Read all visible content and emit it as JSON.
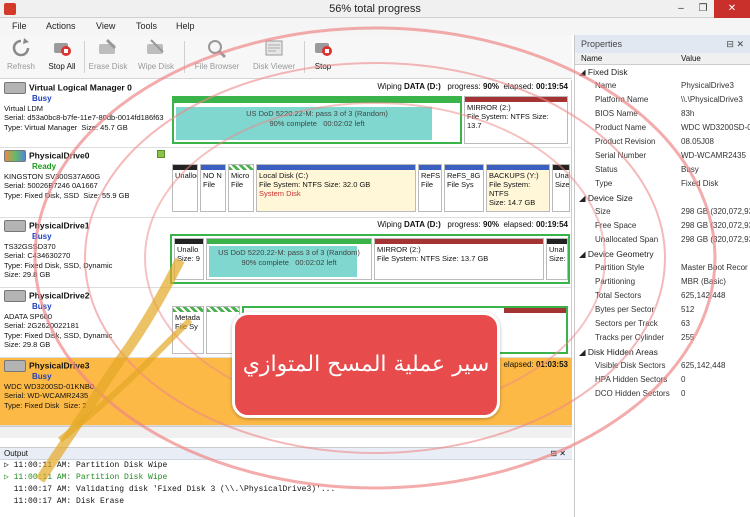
{
  "window": {
    "title": "56% total progress"
  },
  "menu": [
    "File",
    "Actions",
    "View",
    "Tools",
    "Help"
  ],
  "toolbar": [
    {
      "label": "Refresh",
      "enabled": false,
      "icon": "refresh-icon"
    },
    {
      "label": "Stop All",
      "enabled": true,
      "icon": "stop-all-icon"
    },
    {
      "label": "Erase Disk",
      "enabled": false,
      "icon": "erase-disk-icon"
    },
    {
      "label": "Wipe Disk",
      "enabled": false,
      "icon": "wipe-disk-icon"
    },
    {
      "label": "File Browser",
      "enabled": false,
      "icon": "file-browser-icon"
    },
    {
      "label": "Disk Viewer",
      "enabled": false,
      "icon": "disk-viewer-icon"
    },
    {
      "label": "Stop",
      "enabled": true,
      "icon": "stop-icon"
    }
  ],
  "disks": [
    {
      "name": "Virtual Logical Manager 0",
      "status": "Busy",
      "model": "Virtual LDM",
      "serial": "Serial: d53a0bc8-b7fe-11e7-80db-0014fd186f63",
      "type": "Type: Virtual Manager",
      "size": "Size: 45.7 GB",
      "wiping": "Wiping",
      "wipetarget": "DATA (D:)",
      "progress_label": "progress:",
      "progress": "90%",
      "elapsed_label": "elapsed:",
      "elapsed": "00:19:54",
      "p1": {
        "line1": "US DoD 5220.22-M: pass 3 of 3 (Random)",
        "line2": "90% complete",
        "line3": "00:02:02 left"
      },
      "p2": {
        "line1": "MIRROR (2:)",
        "line2": "File System: NTFS Size: 13.7"
      }
    },
    {
      "name": "PhysicalDrive0",
      "status": "Ready",
      "model": "KINGSTON SV300S37A60G",
      "serial": "Serial: 50026B7246 0A1667",
      "type": "Type: Fixed Disk, SSD",
      "size": "Size: 55.9 GB",
      "parts": [
        {
          "l1": "Unalloc",
          "l2": ""
        },
        {
          "l1": "NO N",
          "l2": "File"
        },
        {
          "l1": "Micro",
          "l2": "File"
        },
        {
          "l1": "Local Disk (C:)",
          "l2": "File System: NTFS Size: 32.0 GB",
          "l3": "System Disk"
        },
        {
          "l1": "ReFS",
          "l2": "File"
        },
        {
          "l1": "ReFS_8G",
          "l2": "File Sys"
        },
        {
          "l1": "BACKUPS (Y:)",
          "l2": "File System: NTFS",
          "l3": "Size: 14.7 GB"
        },
        {
          "l1": "Unall",
          "l2": "Size"
        }
      ]
    },
    {
      "name": "PhysicalDrive1",
      "status": "Busy",
      "model": "TS32GSSD370",
      "serial": "Serial: C434630270",
      "type": "Type: Fixed Disk, SSD, Dynamic",
      "size": "Size: 29.8 GB",
      "wiping": "Wiping",
      "wipetarget": "DATA (D:)",
      "progress_label": "progress:",
      "progress": "90%",
      "elapsed_label": "elapsed:",
      "elapsed": "00:19:54",
      "p0": {
        "l1": "Unallo",
        "l2": "Size: 9"
      },
      "p1": {
        "line1": "US DoD 5220.22-M: pass 3 of 3 (Random)",
        "line2": "90% complete",
        "line3": "00:02:02 left"
      },
      "p2": {
        "line1": "MIRROR (2:)",
        "line2": "File System: NTFS Size: 13.7 GB"
      },
      "p3": {
        "l1": "Unal",
        "l2": "Size:"
      }
    },
    {
      "name": "PhysicalDrive2",
      "status": "Busy",
      "model": "ADATA SP600",
      "serial": "Serial: 2G2620022181",
      "type": "Type: Fixed Disk, SSD, Dynamic",
      "size": "Size: 29.8 GB",
      "p0": {
        "l1": "Metada",
        "l2": "File Sy"
      }
    },
    {
      "name": "PhysicalDrive3",
      "status": "Busy",
      "model": "WDC WD3200SD-01KNB0",
      "serial": "Serial: WD-WCAMR2435",
      "type": "Type: Fixed Disk",
      "size": "Size: 2",
      "elapsed_label": "elapsed:",
      "elapsed": "01:03:53"
    }
  ],
  "output": {
    "title": "Output",
    "lines": [
      {
        "t": "11:00:11 AM: Partition Disk Wipe",
        "c": ""
      },
      {
        "t": "11:00:11 AM: Partition Disk Wipe",
        "c": "g"
      },
      {
        "t": "11:00:17 AM: Validating disk 'Fixed Disk 3 (\\\\.\\PhysicalDrive3)'...",
        "c": ""
      },
      {
        "t": "11:00:17 AM: Disk Erase",
        "c": ""
      }
    ]
  },
  "properties": {
    "title": "Properties",
    "col_name": "Name",
    "col_value": "Value",
    "sections": [
      {
        "title": "Fixed Disk",
        "rows": [
          [
            "Name",
            "PhysicalDrive3"
          ],
          [
            "Platform Name",
            "\\\\.\\PhysicalDrive3"
          ],
          [
            "BIOS Name",
            "83h"
          ],
          [
            "Product Name",
            "WDC WD3200SD-0"
          ],
          [
            "Product Revision",
            "08.05J08"
          ],
          [
            "Serial Number",
            "WD-WCAMR2435"
          ],
          [
            "Status",
            "Busy"
          ],
          [
            "Type",
            "Fixed Disk"
          ]
        ]
      },
      {
        "title": "Device Size",
        "rows": [
          [
            "Size",
            "298 GB (320,072,93"
          ],
          [
            "Free Space",
            "298 GB (320,072,93"
          ],
          [
            "Unallocated Span",
            "298 GB (320,072,93"
          ]
        ]
      },
      {
        "title": "Device Geometry",
        "rows": [
          [
            "Partition Style",
            "Master Boot Recor"
          ],
          [
            "Partitioning",
            "MBR (Basic)"
          ],
          [
            "Total Sectors",
            "625,142,448"
          ],
          [
            "Bytes per Sector",
            "512"
          ],
          [
            "Sectors per Track",
            "63"
          ],
          [
            "Tracks per Cylinder",
            "255"
          ]
        ]
      },
      {
        "title": "Disk Hidden Areas",
        "rows": [
          [
            "Visible Disk Sectors",
            "625,142,448"
          ],
          [
            "HPA Hidden Sectors",
            "0"
          ],
          [
            "DCO Hidden Sectors",
            "0"
          ]
        ]
      }
    ]
  },
  "watermark": {
    "banner": "سير عملية المسح المتوازي"
  },
  "colors": {
    "accent": "#fcb945",
    "progress": "#7fd7cf",
    "banner": "#e84b4b",
    "ready": "#1a9c1a",
    "busy": "#1d3fc0"
  }
}
